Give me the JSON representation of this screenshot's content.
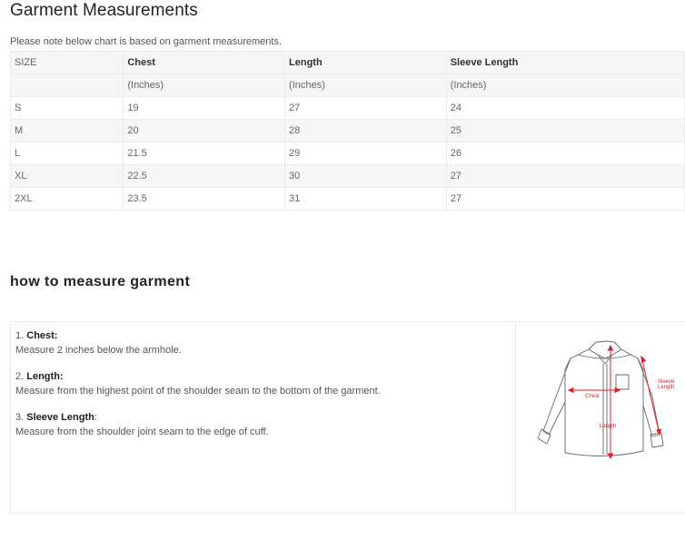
{
  "page": {
    "title": "Garment Measurements",
    "note": "Please note below chart is based on garment measurements."
  },
  "size_table": {
    "header": [
      "SIZE",
      "Chest",
      "Length",
      "Sleeve Length"
    ],
    "units": [
      "",
      "(Inches)",
      "(Inches)",
      "(Inches)"
    ],
    "rows": [
      [
        "S",
        "19",
        "27",
        "24"
      ],
      [
        "M",
        "20",
        "28",
        "25"
      ],
      [
        "L",
        "21.5",
        "29",
        "26"
      ],
      [
        "XL",
        "22.5",
        "30",
        "27"
      ],
      [
        "2XL",
        "23.5",
        "31",
        "27"
      ]
    ]
  },
  "how_to": {
    "title": "how to measure garment",
    "items": [
      {
        "num": "1.",
        "label": "Chest:",
        "desc": "Measure 2 inches below the armhole."
      },
      {
        "num": "2.",
        "label": "Length:",
        "desc": "Measure from the highest point of the shoulder seam to the bottom of the garment."
      },
      {
        "num": "3.",
        "label": "Sleeve Length",
        "sep": ":",
        "desc": "Measure from the shoulder joint seam to the edge of cuff."
      }
    ],
    "diagram": {
      "icon": "shirt-measurement-diagram",
      "labels": {
        "chest": "Chest",
        "length": "Length",
        "sleeve_1": "Sleeve",
        "sleeve_2": "Length"
      },
      "accent_color": "#e02020"
    }
  }
}
